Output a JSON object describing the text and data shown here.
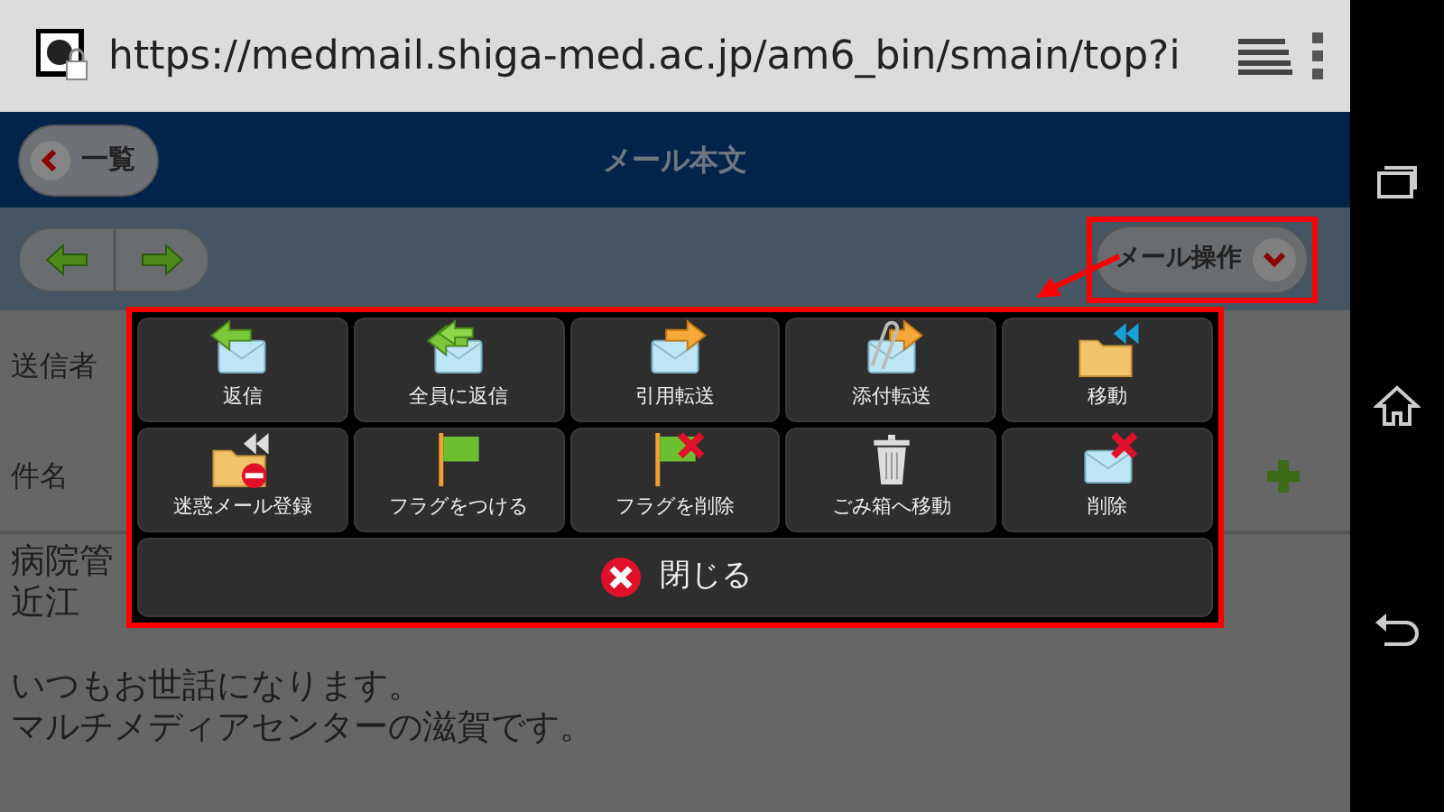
{
  "browser": {
    "url": "https://medmail.shiga-med.ac.jp/am6_bin/smain/top?i"
  },
  "header": {
    "back_button": "一覧",
    "title": "メール本文"
  },
  "toolbar": {
    "mail_actions_button": "メール操作"
  },
  "fields": [
    {
      "label": "送信者"
    },
    {
      "label": "件名"
    }
  ],
  "body_paragraphs": [
    [
      "病院管",
      "近江"
    ],
    [
      "いつもお世話になります。",
      "マルチメディアセンターの滋賀です。"
    ]
  ],
  "menu": {
    "items": [
      {
        "kind": "reply",
        "label": "返信"
      },
      {
        "kind": "reply-all",
        "label": "全員に返信"
      },
      {
        "kind": "forward",
        "label": "引用転送"
      },
      {
        "kind": "forward-attach",
        "label": "添付転送"
      },
      {
        "kind": "move",
        "label": "移動"
      },
      {
        "kind": "spam",
        "label": "迷惑メール登録"
      },
      {
        "kind": "flag",
        "label": "フラグをつける"
      },
      {
        "kind": "unflag",
        "label": "フラグを削除"
      },
      {
        "kind": "trash",
        "label": "ごみ箱へ移動"
      },
      {
        "kind": "delete",
        "label": "削除"
      }
    ],
    "close_button": "閉じる"
  }
}
